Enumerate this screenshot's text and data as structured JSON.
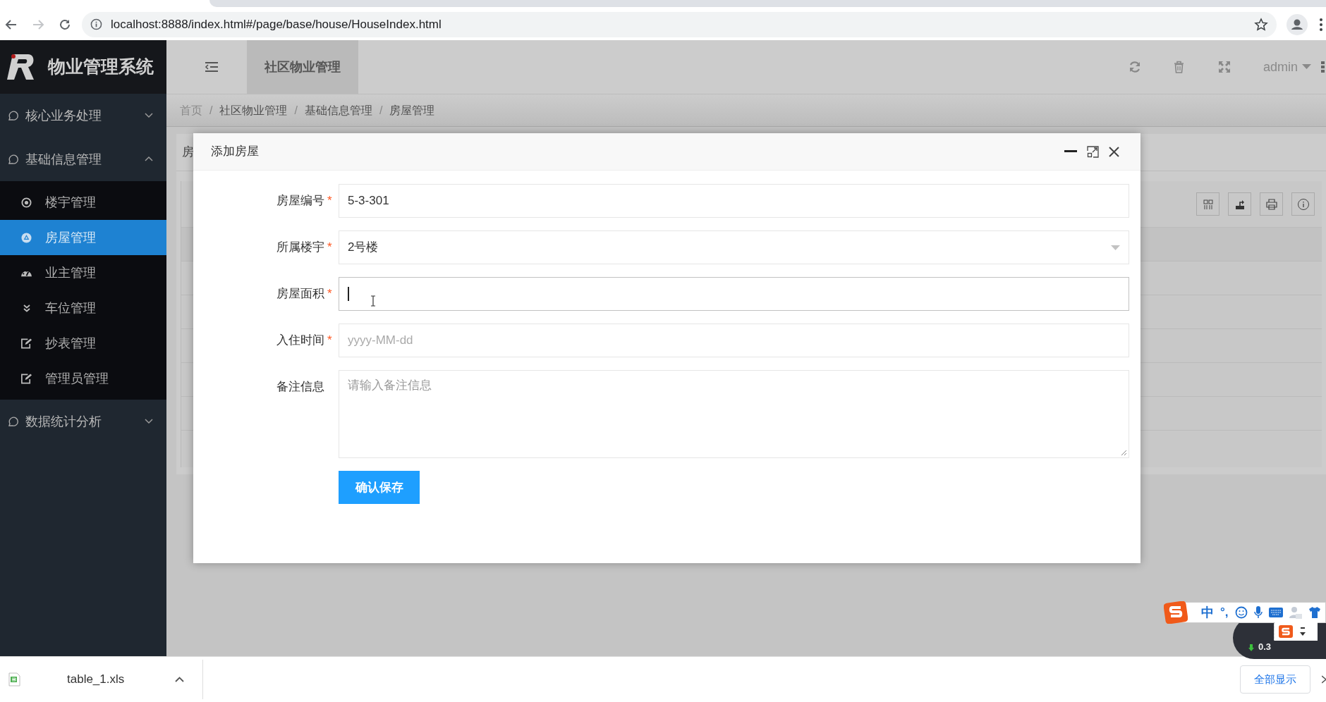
{
  "browser": {
    "url": "localhost:8888/index.html#/page/base/house/HouseIndex.html",
    "forward_disabled": true
  },
  "app": {
    "title": "物业管理系统"
  },
  "header": {
    "tabs": [
      {
        "label": "社区物业管理",
        "selected": true
      }
    ],
    "user": "admin"
  },
  "breadcrumb": {
    "separator": "/",
    "items": [
      "首页",
      "社区物业管理",
      "基础信息管理",
      "房屋管理"
    ]
  },
  "sidebar": {
    "items": [
      {
        "label": "核心业务处理",
        "expanded": false
      },
      {
        "label": "基础信息管理",
        "expanded": true,
        "children": [
          {
            "label": "楼宇管理",
            "kind": "target",
            "selected": false
          },
          {
            "label": "房屋管理",
            "kind": "triangle",
            "selected": true
          },
          {
            "label": "业主管理",
            "kind": "gauge",
            "selected": false
          },
          {
            "label": "车位管理",
            "kind": "chevrons",
            "selected": false
          },
          {
            "label": "抄表管理",
            "kind": "edit",
            "selected": false
          },
          {
            "label": "管理员管理",
            "kind": "edit",
            "selected": false
          }
        ]
      },
      {
        "label": "数据统计分析",
        "expanded": false
      }
    ]
  },
  "background_panel": {
    "title": "房"
  },
  "dialog": {
    "title": "添加房屋",
    "required_mark": "*",
    "fields": [
      {
        "kind": "text",
        "label": "房屋编号",
        "required": true,
        "value": "5-3-301",
        "focused": false
      },
      {
        "kind": "select",
        "label": "所属楼宇",
        "required": true,
        "value": "2号楼",
        "focused": false
      },
      {
        "kind": "text",
        "label": "房屋面积",
        "required": true,
        "focused": true
      },
      {
        "kind": "text",
        "label": "入住时间",
        "required": true,
        "placeholder": "yyyy-MM-dd",
        "focused": false
      },
      {
        "kind": "textarea",
        "label": "备注信息",
        "required": false,
        "placeholder": "请输入备注信息",
        "focused": false
      }
    ],
    "submit": "确认保存"
  },
  "ime": {
    "mode": "中",
    "punctuation": "°,"
  },
  "net_speed": "0.3",
  "downloads": {
    "file": "table_1.xls",
    "show_all": "全部显示"
  }
}
